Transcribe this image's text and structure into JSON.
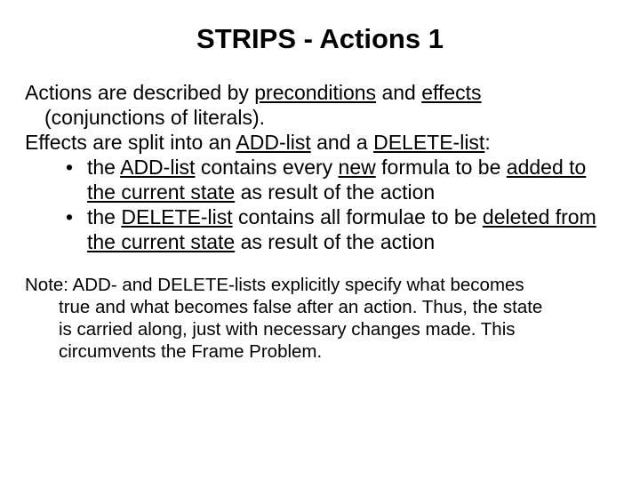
{
  "title": "STRIPS - Actions 1",
  "p1": {
    "a": "Actions are described by ",
    "pre": "preconditions",
    "b": " and ",
    "eff": "effects",
    "cont": "(conjunctions of literals)."
  },
  "p2": {
    "a": "Effects are split into an ",
    "add": "ADD-list",
    "b": " and a ",
    "del": "DELETE-list",
    "c": ":"
  },
  "b1": {
    "a": "the ",
    "add": "ADD-list",
    "b": " contains every ",
    "newf": "new",
    "c": " formula to be ",
    "added": "added to the current state",
    "d": " as result of the action"
  },
  "b2": {
    "a": "the ",
    "del": "DELETE-list",
    "b": " contains all formulae to be ",
    "deleted": "deleted from the current state",
    "c": " as result of the action"
  },
  "note": {
    "line1": "Note: ADD- and DELETE-lists explicitly specify what becomes",
    "line2": "true and what becomes false after an action. Thus, the state",
    "line3": "is carried along, just with necessary changes made. This",
    "line4": "circumvents the Frame Problem."
  }
}
